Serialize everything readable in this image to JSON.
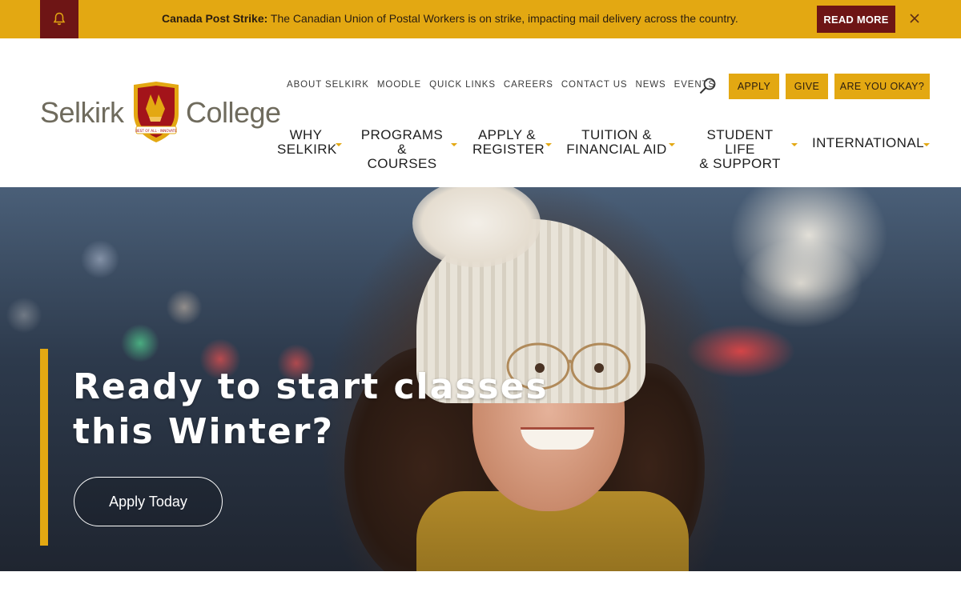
{
  "alert": {
    "icon": "bell-icon",
    "title": "Canada Post Strike:",
    "message": " The Canadian Union of Postal Workers is on strike, impacting mail delivery across the country.",
    "read_more": "READ MORE",
    "close_icon": "close-icon",
    "bg_color": "#e3a812",
    "accent_color": "#6e1515"
  },
  "logo": {
    "left": "Selkirk",
    "right": "College",
    "crest_motto": "BEST OF ALL · INNOVATE"
  },
  "utility_nav": [
    "ABOUT SELKIRK",
    "MOODLE",
    "QUICK LINKS",
    "CAREERS",
    "CONTACT US",
    "NEWS",
    "EVENTS"
  ],
  "header_buttons": {
    "apply": "APPLY",
    "give": "GIVE",
    "okay": "ARE YOU OKAY?"
  },
  "main_nav": [
    {
      "line1": "WHY",
      "line2": "SELKIRK"
    },
    {
      "line1": "PROGRAMS &",
      "line2": "COURSES"
    },
    {
      "line1": "APPLY &",
      "line2": "REGISTER"
    },
    {
      "line1": "TUITION &",
      "line2": "FINANCIAL AID"
    },
    {
      "line1": "STUDENT LIFE",
      "line2": "& SUPPORT"
    },
    {
      "line1": "INTERNATIONAL",
      "line2": ""
    }
  ],
  "hero": {
    "title_line1": "Ready to start classes",
    "title_line2": "this Winter?",
    "cta": "Apply Today"
  }
}
